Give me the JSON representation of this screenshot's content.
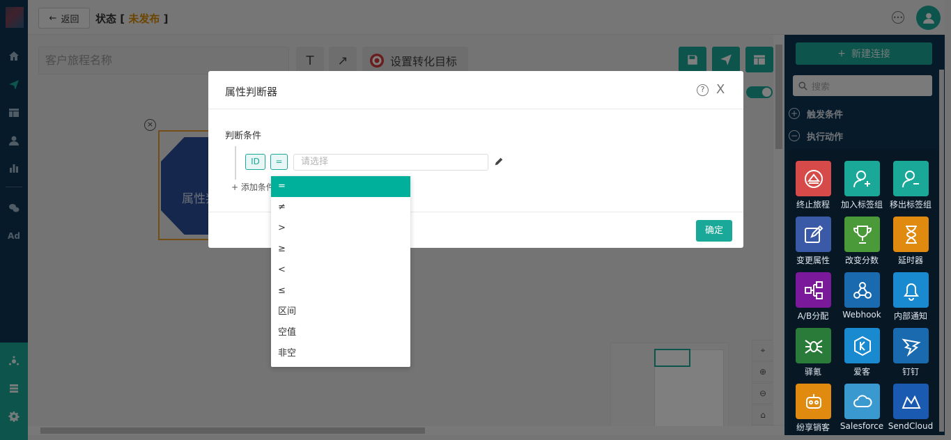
{
  "header": {
    "back_label": "返回",
    "title": "状态",
    "status_label": "未发布",
    "status_open": "[",
    "status_close": "]"
  },
  "toolbar": {
    "journey_name_placeholder": "客户旅程名称",
    "text_tool": "T",
    "arrow_tool": "↗",
    "goal_label": "设置转化目标"
  },
  "canvas": {
    "node_label": "属性判"
  },
  "right_panel": {
    "new_connection_label": "新建连接",
    "search_placeholder": "搜索",
    "sections": [
      {
        "label": "触发条件",
        "state": "+"
      },
      {
        "label": "执行动作",
        "state": "−"
      }
    ],
    "actions": [
      {
        "label": "终止旅程",
        "icon": "eject-icon",
        "color": "#d64a4a"
      },
      {
        "label": "加入标签组",
        "icon": "user-add-icon",
        "color": "#1aa998"
      },
      {
        "label": "移出标签组",
        "icon": "user-remove-icon",
        "color": "#1aa998"
      },
      {
        "label": "变更属性",
        "icon": "edit-icon",
        "color": "#3a5aa8"
      },
      {
        "label": "改变分数",
        "icon": "trophy-icon",
        "color": "#4a9a3a"
      },
      {
        "label": "延时器",
        "icon": "hourglass-icon",
        "color": "#e08a10"
      },
      {
        "label": "A/B分配",
        "icon": "ab-split-icon",
        "color": "#7a1a9a"
      },
      {
        "label": "Webhook",
        "icon": "webhook-icon",
        "color": "#1a6ab0"
      },
      {
        "label": "内部通知",
        "icon": "bell-icon",
        "color": "#1a8ad0"
      },
      {
        "label": "驿氪",
        "icon": "spider-icon",
        "color": "#2a7a3a"
      },
      {
        "label": "爱客",
        "icon": "k-icon",
        "color": "#1a8ad0"
      },
      {
        "label": "钉钉",
        "icon": "dingtalk-icon",
        "color": "#1a6ab0"
      },
      {
        "label": "纷享销客",
        "icon": "robot-icon",
        "color": "#e08a10"
      },
      {
        "label": "Salesforce",
        "icon": "cloud-icon",
        "color": "#3a9ad0"
      },
      {
        "label": "SendCloud",
        "icon": "sendcloud-icon",
        "color": "#1a5ab0"
      }
    ]
  },
  "modal": {
    "title": "属性判断器",
    "help_icon": "?",
    "close_icon": "X",
    "condition_label": "判断条件",
    "field_tag": "ID",
    "operator_tag": "=",
    "value_placeholder": "请选择",
    "add_condition": "+ 添加条件",
    "confirm_label": "确定"
  },
  "dropdown": {
    "options": [
      "=",
      "≠",
      ">",
      "≥",
      "<",
      "≤",
      "区间",
      "空值",
      "非空"
    ],
    "selected_index": 0
  },
  "colors": {
    "accent": "#1aa998",
    "nav": "#0e3453",
    "unpublished": "#d88a00"
  }
}
